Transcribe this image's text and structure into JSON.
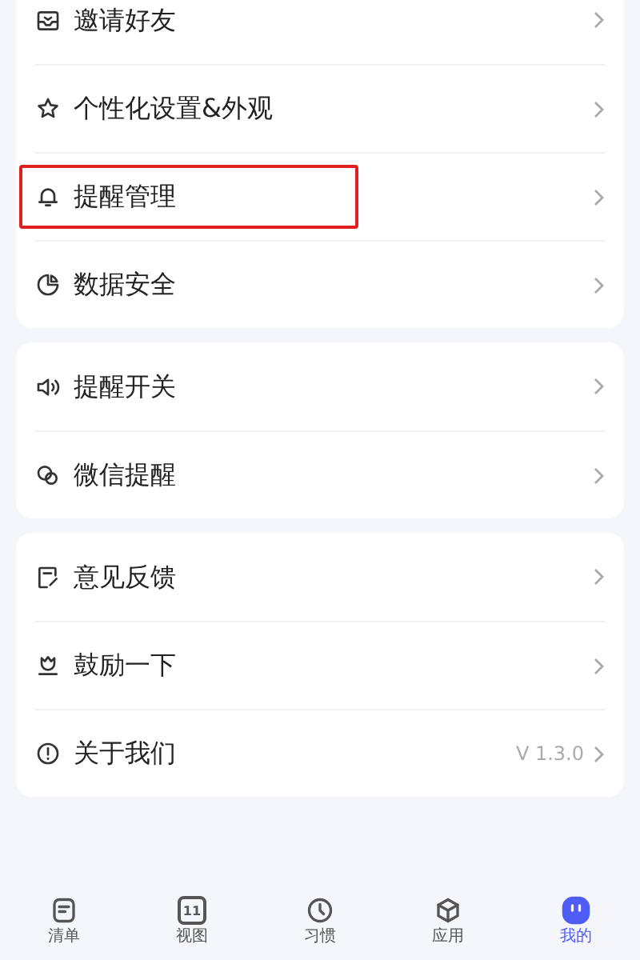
{
  "groups": [
    {
      "items": [
        {
          "kind": "mail",
          "label": "邀请好友",
          "highlighted": false
        },
        {
          "kind": "star",
          "label": "个性化设置&外观",
          "highlighted": false
        },
        {
          "kind": "bell",
          "label": "提醒管理",
          "highlighted": true
        },
        {
          "kind": "pie",
          "label": "数据安全",
          "highlighted": false
        }
      ]
    },
    {
      "items": [
        {
          "kind": "speaker",
          "label": "提醒开关",
          "highlighted": false
        },
        {
          "kind": "chat",
          "label": "微信提醒",
          "highlighted": false
        }
      ]
    },
    {
      "items": [
        {
          "kind": "edit",
          "label": "意见反馈",
          "highlighted": false
        },
        {
          "kind": "flower",
          "label": "鼓励一下",
          "highlighted": false
        },
        {
          "kind": "info",
          "label": "关于我们",
          "highlighted": false,
          "value": "V 1.3.0"
        }
      ]
    }
  ],
  "nav": [
    {
      "kind": "list",
      "label": "清单",
      "selected": false
    },
    {
      "kind": "calendar",
      "label": "视图",
      "selected": false,
      "day": "11"
    },
    {
      "kind": "clock",
      "label": "习惯",
      "selected": false
    },
    {
      "kind": "cube",
      "label": "应用",
      "selected": false
    },
    {
      "kind": "person",
      "label": "我的",
      "selected": true
    }
  ]
}
